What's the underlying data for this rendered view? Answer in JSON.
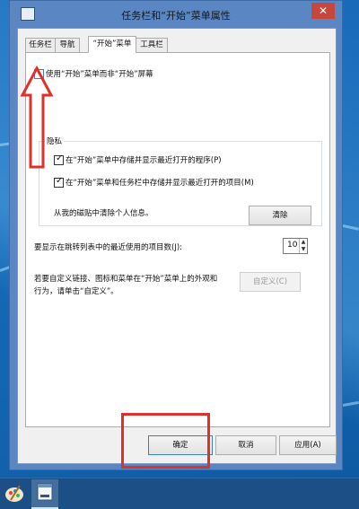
{
  "window": {
    "title": "任务栏和“开始”菜单属性",
    "close_glyph": "✕"
  },
  "tabs": [
    {
      "label": "任务栏",
      "active": false
    },
    {
      "label": "导航",
      "active": false
    },
    {
      "label": "“开始”菜单",
      "active": true
    },
    {
      "label": "工具栏",
      "active": false
    }
  ],
  "start_screen": {
    "label": "使用“开始”菜单而非“开始”屏幕",
    "checked": false
  },
  "privacy": {
    "title": "隐私",
    "options": [
      {
        "label": "在“开始”菜单中存储并显示最近打开的程序(P)",
        "checked": true
      },
      {
        "label": "在“开始”菜单和任务栏中存储并显示最近打开的项目(M)",
        "checked": true
      }
    ],
    "clear_label": "从我的磁贴中清除个人信息。",
    "clear_button": "清除"
  },
  "jumplist": {
    "label": "要显示在跳转列表中的最近使用的项目数(J):",
    "value": "10",
    "up_glyph": "▲",
    "down_glyph": "▼"
  },
  "customize": {
    "line1": "若要自定义链接、图标和菜单在“开始”菜单上的外观和",
    "line2": "行为，请单击“自定义”。",
    "button": "自定义(C)"
  },
  "footer": {
    "ok": "确定",
    "cancel": "取消",
    "apply": "应用(A)"
  },
  "colors": {
    "annotation": "#e0302a",
    "desktop": "#1669b8",
    "title_bar": "#5a86c3"
  }
}
